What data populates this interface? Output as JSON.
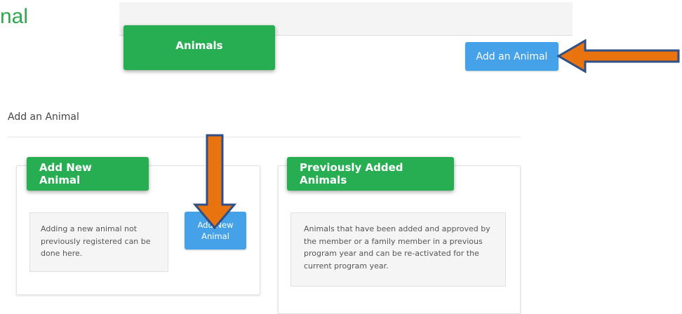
{
  "slide": {
    "title_fragment": "nal"
  },
  "top": {
    "animals_tile_label": "Animals",
    "add_animal_button": "Add an Animal"
  },
  "section": {
    "title": "Add an Animal"
  },
  "cards": {
    "new_animal": {
      "tile_label": "Add New Animal",
      "description": "Adding a new animal not previously registered can be done here.",
      "button_line1": "Add New",
      "button_line2": "Animal"
    },
    "previous_animals": {
      "tile_label": "Previously Added Animals",
      "description": "Animals that have been added and approved by the member or a family member in a previous program year and can be re-activated for the current program year."
    }
  },
  "colors": {
    "green_accent": "#27ae52",
    "blue_button": "#45a1e8",
    "arrow_fill": "#e8730f",
    "arrow_outline": "#2f4f86"
  },
  "annotations": [
    {
      "icon": "arrow-left-icon",
      "target": "add-an-animal-button"
    },
    {
      "icon": "arrow-down-icon",
      "target": "add-new-animal-button"
    }
  ]
}
